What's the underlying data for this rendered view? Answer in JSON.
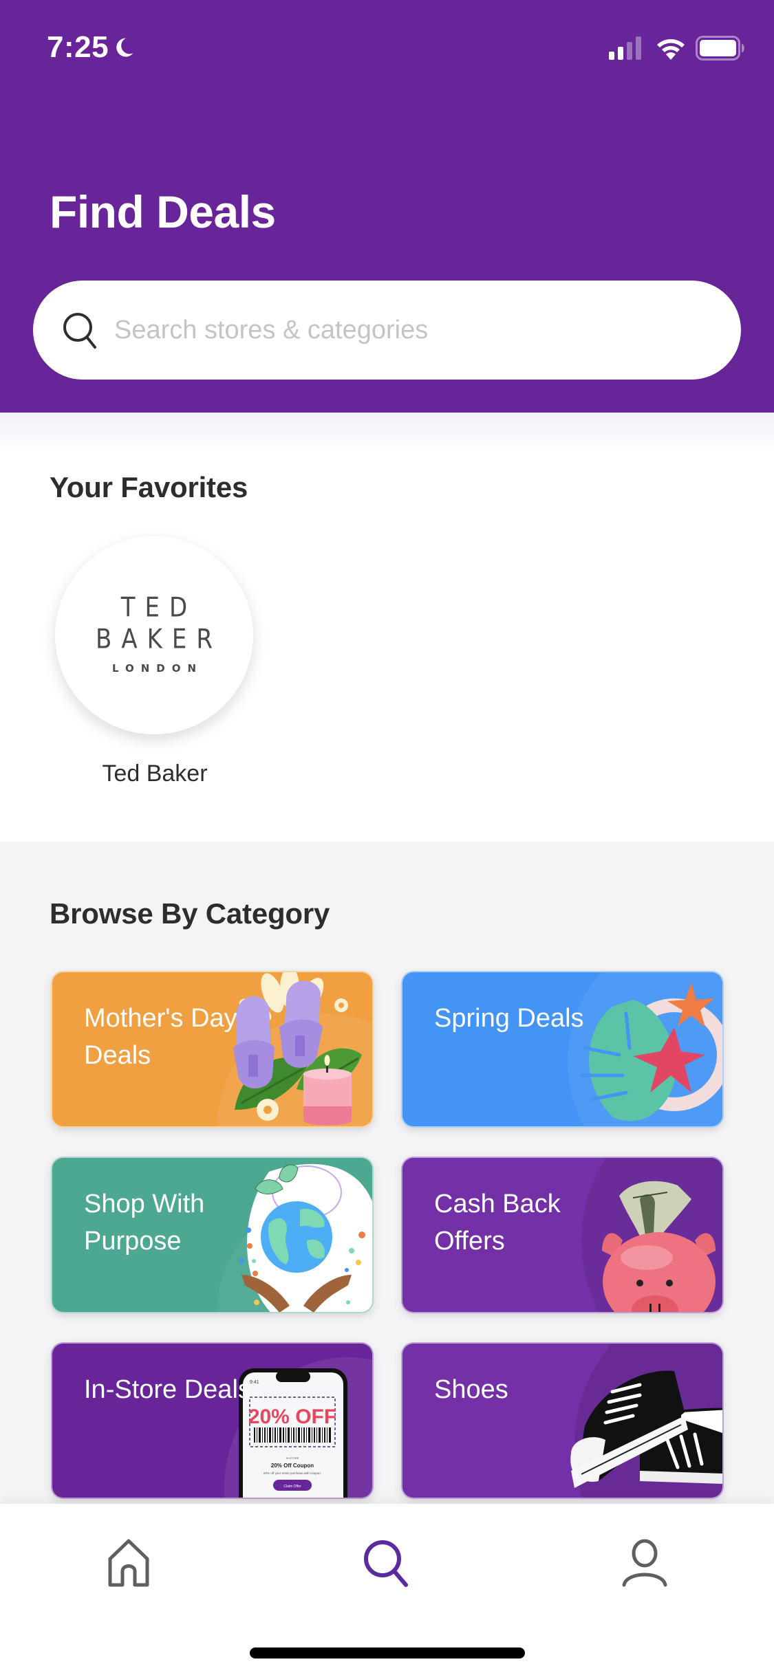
{
  "status_bar": {
    "time": "7:25",
    "focus_icon": "moon-icon",
    "signal_icon": "cellular-signal-icon",
    "wifi_icon": "wifi-icon",
    "battery_icon": "battery-icon",
    "signal_bars_active": 2,
    "signal_bars_total": 4
  },
  "header": {
    "title": "Find Deals",
    "background_color": "#68259a"
  },
  "search": {
    "icon": "search-icon",
    "placeholder": "Search stores & categories",
    "value": ""
  },
  "favorites": {
    "title": "Your Favorites",
    "items": [
      {
        "name": "Ted Baker",
        "logo_line1": "TED BAKER",
        "logo_line2": "LONDON"
      }
    ]
  },
  "browse": {
    "title": "Browse By Category",
    "categories": [
      {
        "label": "Mother's Day Deals",
        "color": "#f0a040",
        "art": "slippers-candle-flowers-image"
      },
      {
        "label": "Spring Deals",
        "color": "#4394f5",
        "art": "tropical-leaf-flowers-image"
      },
      {
        "label": "Shop With Purpose",
        "color": "#4ca891",
        "art": "globe-in-hands-image"
      },
      {
        "label": "Cash Back Offers",
        "color": "#7430a6",
        "art": "piggy-bank-dollar-image"
      },
      {
        "label": "In-Store Deals",
        "color": "#68259a",
        "art": "phone-coupon-image",
        "coupon": {
          "time": "9:41",
          "headline": "20% OFF",
          "tag": "IN STORE",
          "title": "20% Off Coupon",
          "desc": "20% off your entire purchase with coupon.",
          "button": "Claim Offer"
        }
      },
      {
        "label": "Shoes",
        "color": "#7430a6",
        "art": "sneakers-image"
      }
    ]
  },
  "tabbar": {
    "active_color": "#5b2a9e",
    "inactive_color": "#5f5f5f",
    "tabs": [
      {
        "name": "home",
        "icon": "home-icon",
        "active": false
      },
      {
        "name": "search",
        "icon": "search-icon",
        "active": true
      },
      {
        "name": "account",
        "icon": "person-icon",
        "active": false
      }
    ]
  }
}
